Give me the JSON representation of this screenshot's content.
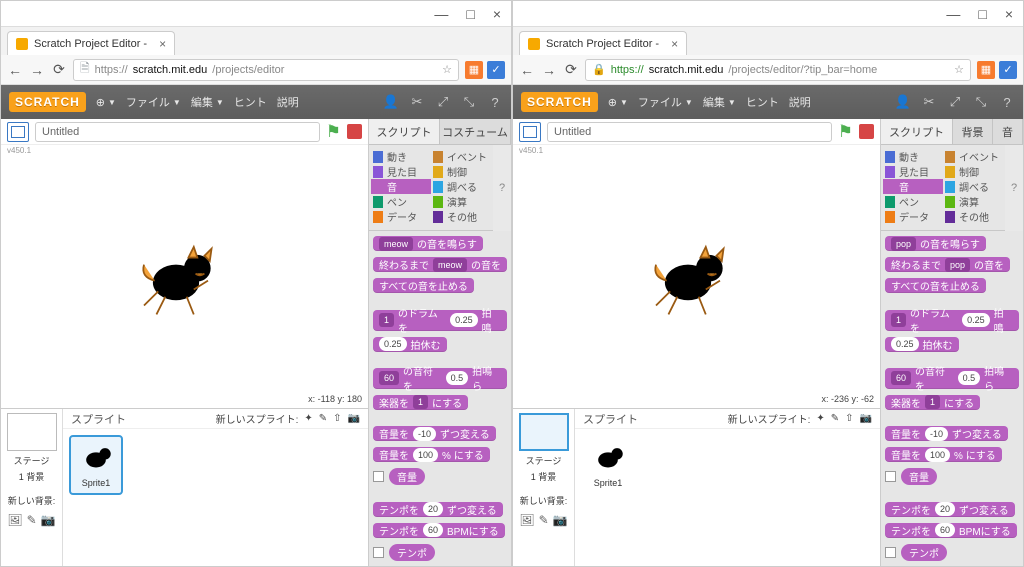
{
  "browser": {
    "tab_title": "Scratch Project Editor - ",
    "close": "×",
    "min": "—",
    "max": "□"
  },
  "left": {
    "url_scheme": "https://",
    "url_host": "scratch.mit.edu",
    "url_path": "/projects/editor",
    "secure": false
  },
  "right": {
    "url_scheme": "https://",
    "url_host": "scratch.mit.edu",
    "url_path": "/projects/editor/?tip_bar=home",
    "secure": true
  },
  "menu": {
    "logo": "SCRATCH",
    "globe": "⊕",
    "file": "ファイル",
    "edit": "編集",
    "hint": "ヒント",
    "about": "説明"
  },
  "project": {
    "title": "Untitled",
    "version": "v450.1"
  },
  "coords": {
    "left": "x: -118  y: 180",
    "right": "x: -236  y: -62"
  },
  "tabs": {
    "scripts": "スクリプト",
    "costumes": "コスチューム",
    "backdrops": "背景",
    "sounds": "音"
  },
  "categories": {
    "motion": "動き",
    "looks": "見た目",
    "sound": "音",
    "pen": "ペン",
    "data": "データ",
    "events": "イベント",
    "control": "制御",
    "sensing": "調べる",
    "operators": "演算",
    "more": "その他"
  },
  "sound_dropdown_left": "meow",
  "sound_dropdown_right": "pop",
  "blocks": {
    "play_sound_suffix": "の音を鳴らす",
    "play_until_prefix": "終わるまで",
    "play_until_suffix": "の音を",
    "stop_all": "すべての音を止める",
    "drum_mid": "のドラムを",
    "drum_beats": "0.25",
    "drum_suffix": "拍鳴",
    "rest": "拍休む",
    "rest_val": "0.25",
    "note_mid": "の音符を",
    "note_beats": "0.5",
    "note_suffix": "拍鳴ら",
    "note_val": "60",
    "instrument_prefix": "楽器を",
    "instrument_suffix": "にする",
    "instrument_val": "1",
    "vol_change_prefix": "音量を",
    "vol_change_suffix": "ずつ変える",
    "vol_change_val": "-10",
    "vol_set_prefix": "音量を",
    "vol_set_suffix": "% にする",
    "vol_set_val": "100",
    "vol_reporter": "音量",
    "tempo_change_prefix": "テンポを",
    "tempo_change_suffix": "ずつ変える",
    "tempo_change_val": "20",
    "tempo_set_prefix": "テンポを",
    "tempo_set_suffix": "BPMにする",
    "tempo_set_val": "60",
    "tempo_reporter": "テンポ",
    "drum_val": "1"
  },
  "sprites": {
    "header": "スプライト",
    "new": "新しいスプライト:",
    "sprite1": "Sprite1",
    "stage": "ステージ",
    "backdrop_count": "1 背景",
    "new_backdrop": "新しい背景:"
  }
}
